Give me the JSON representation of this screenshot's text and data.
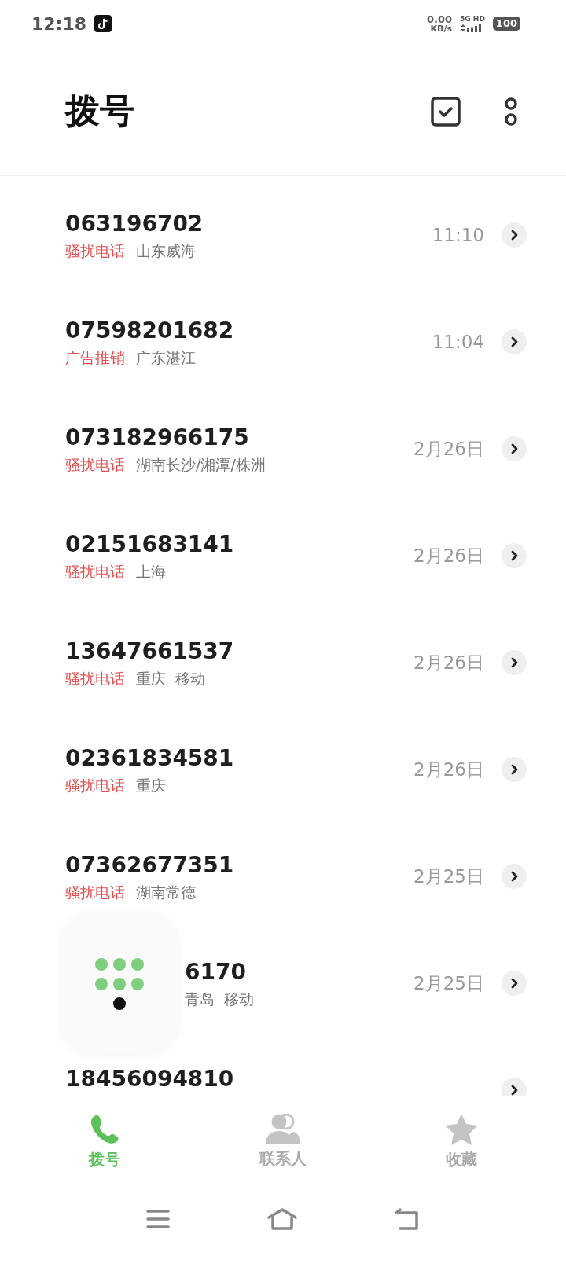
{
  "status_bar": {
    "time": "12:18",
    "speed": "0.00",
    "speed_unit": "KB/s",
    "network": "5G HD",
    "battery": "100"
  },
  "header": {
    "title": "拨号"
  },
  "calls": [
    {
      "number": "063196702",
      "tag": "骚扰电话",
      "location": "山东威海",
      "time": "11:10"
    },
    {
      "number": "07598201682",
      "tag": "广告推销",
      "location": "广东湛江",
      "time": "11:04"
    },
    {
      "number": "073182966175",
      "tag": "骚扰电话",
      "location": "湖南长沙/湘潭/株洲",
      "time": "2月26日"
    },
    {
      "number": "02151683141",
      "tag": "骚扰电话",
      "location": "上海",
      "time": "2月26日"
    },
    {
      "number": "13647661537",
      "tag": "骚扰电话",
      "location": "重庆  移动",
      "time": "2月26日"
    },
    {
      "number": "02361834581",
      "tag": "骚扰电话",
      "location": "重庆",
      "time": "2月26日"
    },
    {
      "number": "07362677351",
      "tag": "骚扰电话",
      "location": "湖南常德",
      "time": "2月25日"
    },
    {
      "number": "6170",
      "location": "青岛  移动",
      "time": "2月25日",
      "covered": true
    },
    {
      "number": "18456094810"
    }
  ],
  "bottom_nav": [
    {
      "label": "拨号",
      "selected": true,
      "kind": "phone"
    },
    {
      "label": "联系人",
      "selected": false,
      "kind": "contacts"
    },
    {
      "label": "收藏",
      "selected": false,
      "kind": "star"
    }
  ]
}
